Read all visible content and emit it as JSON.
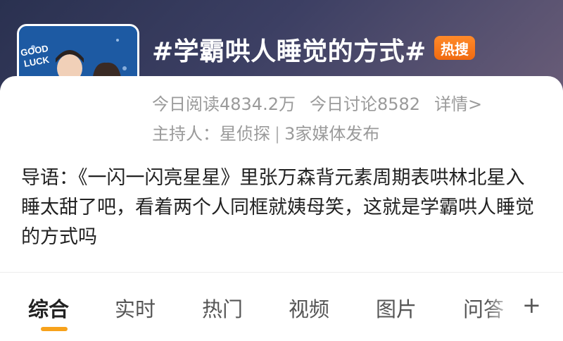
{
  "topic": {
    "title": "#学霸哄人睡觉的方式#",
    "hot_badge": "热搜",
    "reads": "今日阅读4834.2万",
    "discussions": "今日讨论8582",
    "details": "详情>",
    "host_label": "主持人：星侦探",
    "media_count": "3家媒体发布",
    "cover_sign_text": "GOOD LUCK"
  },
  "intro": {
    "text": "导语：《一闪一闪亮星星》里张万森背元素周期表哄林北星入睡太甜了吧，看着两个人同框就姨母笑，这就是学霸哄人睡觉的方式吗"
  },
  "tabs": [
    {
      "label": "综合"
    },
    {
      "label": "实时"
    },
    {
      "label": "热门"
    },
    {
      "label": "视频"
    },
    {
      "label": "图片"
    },
    {
      "label": "问答"
    }
  ],
  "more_tabs_label": "+",
  "colors": {
    "accent": "#f7a21b",
    "hot_badge": "#f06a10",
    "header_bg": "#3c3f63"
  }
}
